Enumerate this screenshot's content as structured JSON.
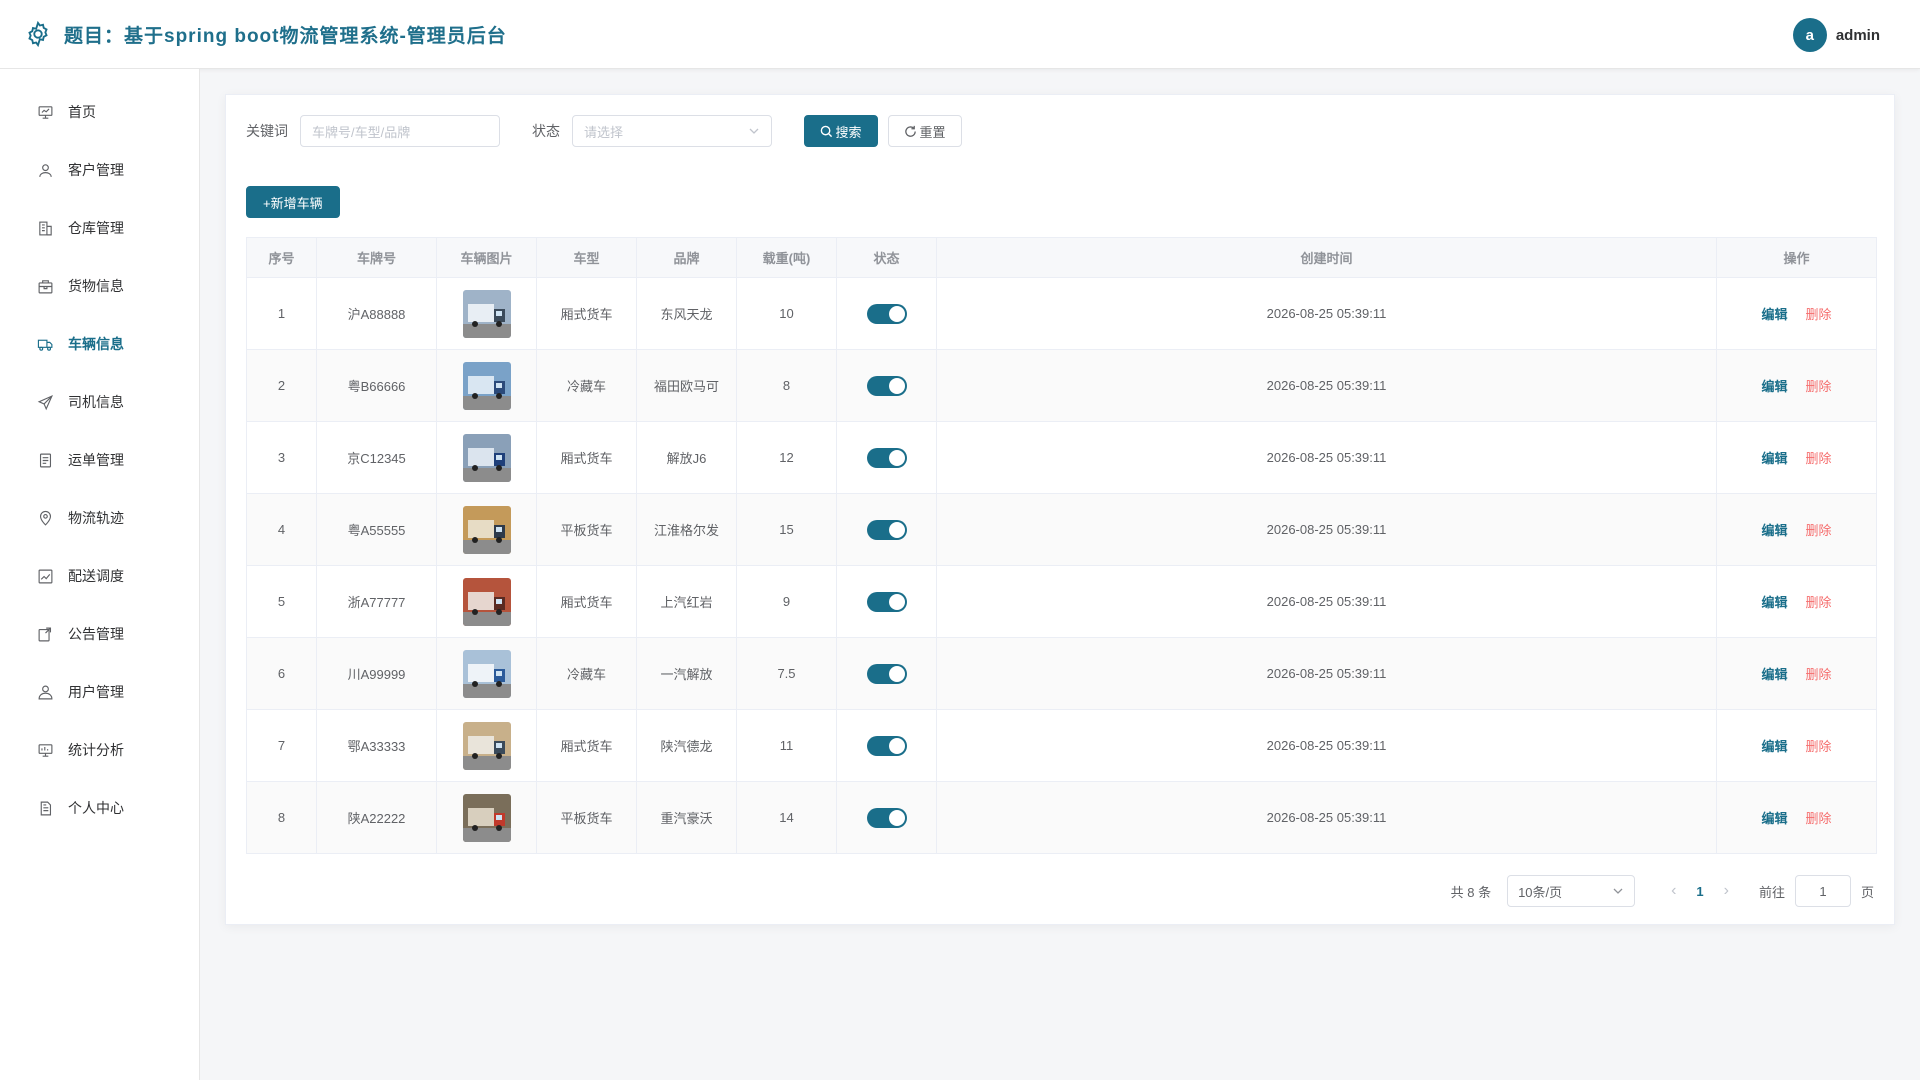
{
  "header": {
    "title": "题目：基于spring boot物流管理系统-管理员后台",
    "avatar_letter": "a",
    "username": "admin"
  },
  "sidebar": {
    "items": [
      {
        "label": "首页",
        "icon": "home-icon"
      },
      {
        "label": "客户管理",
        "icon": "user-icon"
      },
      {
        "label": "仓库管理",
        "icon": "building-icon"
      },
      {
        "label": "货物信息",
        "icon": "box-icon"
      },
      {
        "label": "车辆信息",
        "icon": "truck-icon",
        "active": true
      },
      {
        "label": "司机信息",
        "icon": "send-icon"
      },
      {
        "label": "运单管理",
        "icon": "document-icon"
      },
      {
        "label": "物流轨迹",
        "icon": "location-icon"
      },
      {
        "label": "配送调度",
        "icon": "chart-icon"
      },
      {
        "label": "公告管理",
        "icon": "notice-icon"
      },
      {
        "label": "用户管理",
        "icon": "person-icon"
      },
      {
        "label": "统计分析",
        "icon": "stats-icon"
      },
      {
        "label": "个人中心",
        "icon": "profile-icon"
      }
    ]
  },
  "filter": {
    "keyword_label": "关键词",
    "keyword_placeholder": "车牌号/车型/品牌",
    "status_label": "状态",
    "status_placeholder": "请选择",
    "search_label": "搜索",
    "reset_label": "重置"
  },
  "add_button_label": "+新增车辆",
  "table": {
    "headers": [
      "序号",
      "车牌号",
      "车辆图片",
      "车型",
      "品牌",
      "载重(吨)",
      "状态",
      "创建时间",
      "操作"
    ],
    "edit_label": "编辑",
    "delete_label": "删除",
    "rows": [
      {
        "no": "1",
        "plate": "沪A88888",
        "type": "厢式货车",
        "brand": "东风天龙",
        "load": "10",
        "status": true,
        "created": "2026-08-25 05:39:11"
      },
      {
        "no": "2",
        "plate": "粤B66666",
        "type": "冷藏车",
        "brand": "福田欧马可",
        "load": "8",
        "status": true,
        "created": "2026-08-25 05:39:11"
      },
      {
        "no": "3",
        "plate": "京C12345",
        "type": "厢式货车",
        "brand": "解放J6",
        "load": "12",
        "status": true,
        "created": "2026-08-25 05:39:11"
      },
      {
        "no": "4",
        "plate": "粤A55555",
        "type": "平板货车",
        "brand": "江淮格尔发",
        "load": "15",
        "status": true,
        "created": "2026-08-25 05:39:11"
      },
      {
        "no": "5",
        "plate": "浙A77777",
        "type": "厢式货车",
        "brand": "上汽红岩",
        "load": "9",
        "status": true,
        "created": "2026-08-25 05:39:11"
      },
      {
        "no": "6",
        "plate": "川A99999",
        "type": "冷藏车",
        "brand": "一汽解放",
        "load": "7.5",
        "status": true,
        "created": "2026-08-25 05:39:11"
      },
      {
        "no": "7",
        "plate": "鄂A33333",
        "type": "厢式货车",
        "brand": "陕汽德龙",
        "load": "11",
        "status": true,
        "created": "2026-08-25 05:39:11"
      },
      {
        "no": "8",
        "plate": "陕A22222",
        "type": "平板货车",
        "brand": "重汽豪沃",
        "load": "14",
        "status": true,
        "created": "2026-08-25 05:39:11"
      }
    ]
  },
  "pagination": {
    "total": "共 8 条",
    "page_size": "10条/页",
    "current_page": "1",
    "goto_label": "前往",
    "goto_value": "1",
    "page_suffix": "页"
  },
  "colors": {
    "accent": "#1a6e8a",
    "danger": "#f56c6c"
  }
}
